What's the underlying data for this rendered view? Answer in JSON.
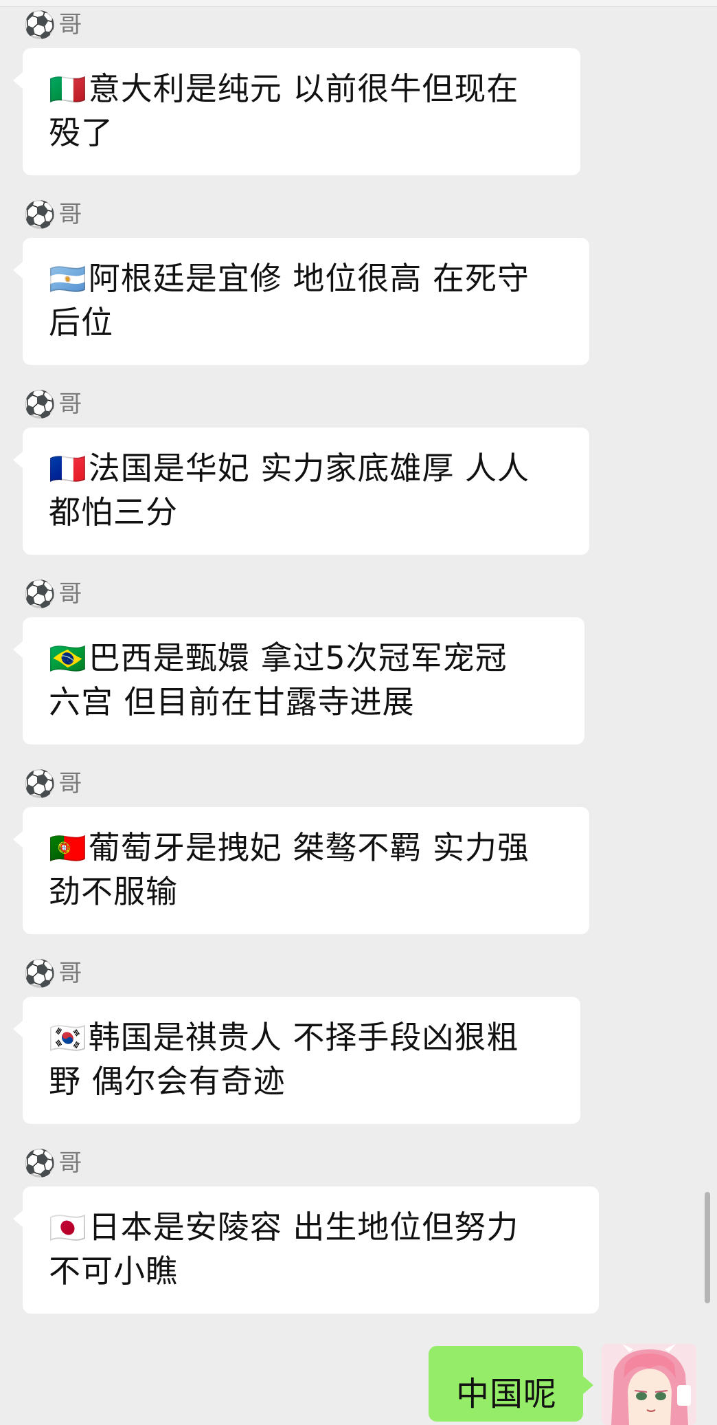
{
  "sender": {
    "icon": "⚽",
    "name": "哥"
  },
  "messages": [
    {
      "flag": "🇮🇹",
      "text": "意大利是纯元 以前很牛但现在殁了",
      "line1": "意大利是纯元 以前很牛但现在",
      "line2": "殁了"
    },
    {
      "flag": "🇦🇷",
      "text": "阿根廷是宜修 地位很高 在死守后位",
      "line1": "阿根廷是宜修 地位很高 在死守",
      "line2": "后位"
    },
    {
      "flag": "🇫🇷",
      "text": "法国是华妃 实力家底雄厚 人人都怕三分",
      "line1": "法国是华妃 实力家底雄厚 人人",
      "line2": "都怕三分"
    },
    {
      "flag": "🇧🇷",
      "text": "巴西是甄嬛  拿过5次冠军宠冠六宫  但目前在甘露寺进展",
      "line1": "巴西是甄嬛  拿过5次冠军宠冠",
      "line2": "六宫  但目前在甘露寺进展"
    },
    {
      "flag": "🇵🇹",
      "text": "葡萄牙是拽妃 桀骜不羁 实力强劲不服输",
      "line1": "葡萄牙是拽妃 桀骜不羁 实力强",
      "line2": "劲不服输"
    },
    {
      "flag": "🇰🇷",
      "text": "韩国是祺贵人 不择手段凶狠粗野 偶尔会有奇迹",
      "line1": "韩国是祺贵人 不择手段凶狠粗",
      "line2": "野 偶尔会有奇迹"
    },
    {
      "flag": "🇯🇵",
      "text": "日本是安陵容 出生地位但努力不可小瞧",
      "line1": "日本是安陵容 出生地位但努力",
      "line2": "不可小瞧"
    }
  ],
  "my_message": {
    "text": "中国呢"
  },
  "icons": {
    "sender_icon": "soccer-ball-icon",
    "avatar": "anime-avatar"
  },
  "colors": {
    "background": "#ededed",
    "incoming_bubble": "#ffffff",
    "outgoing_bubble": "#95ec69"
  }
}
